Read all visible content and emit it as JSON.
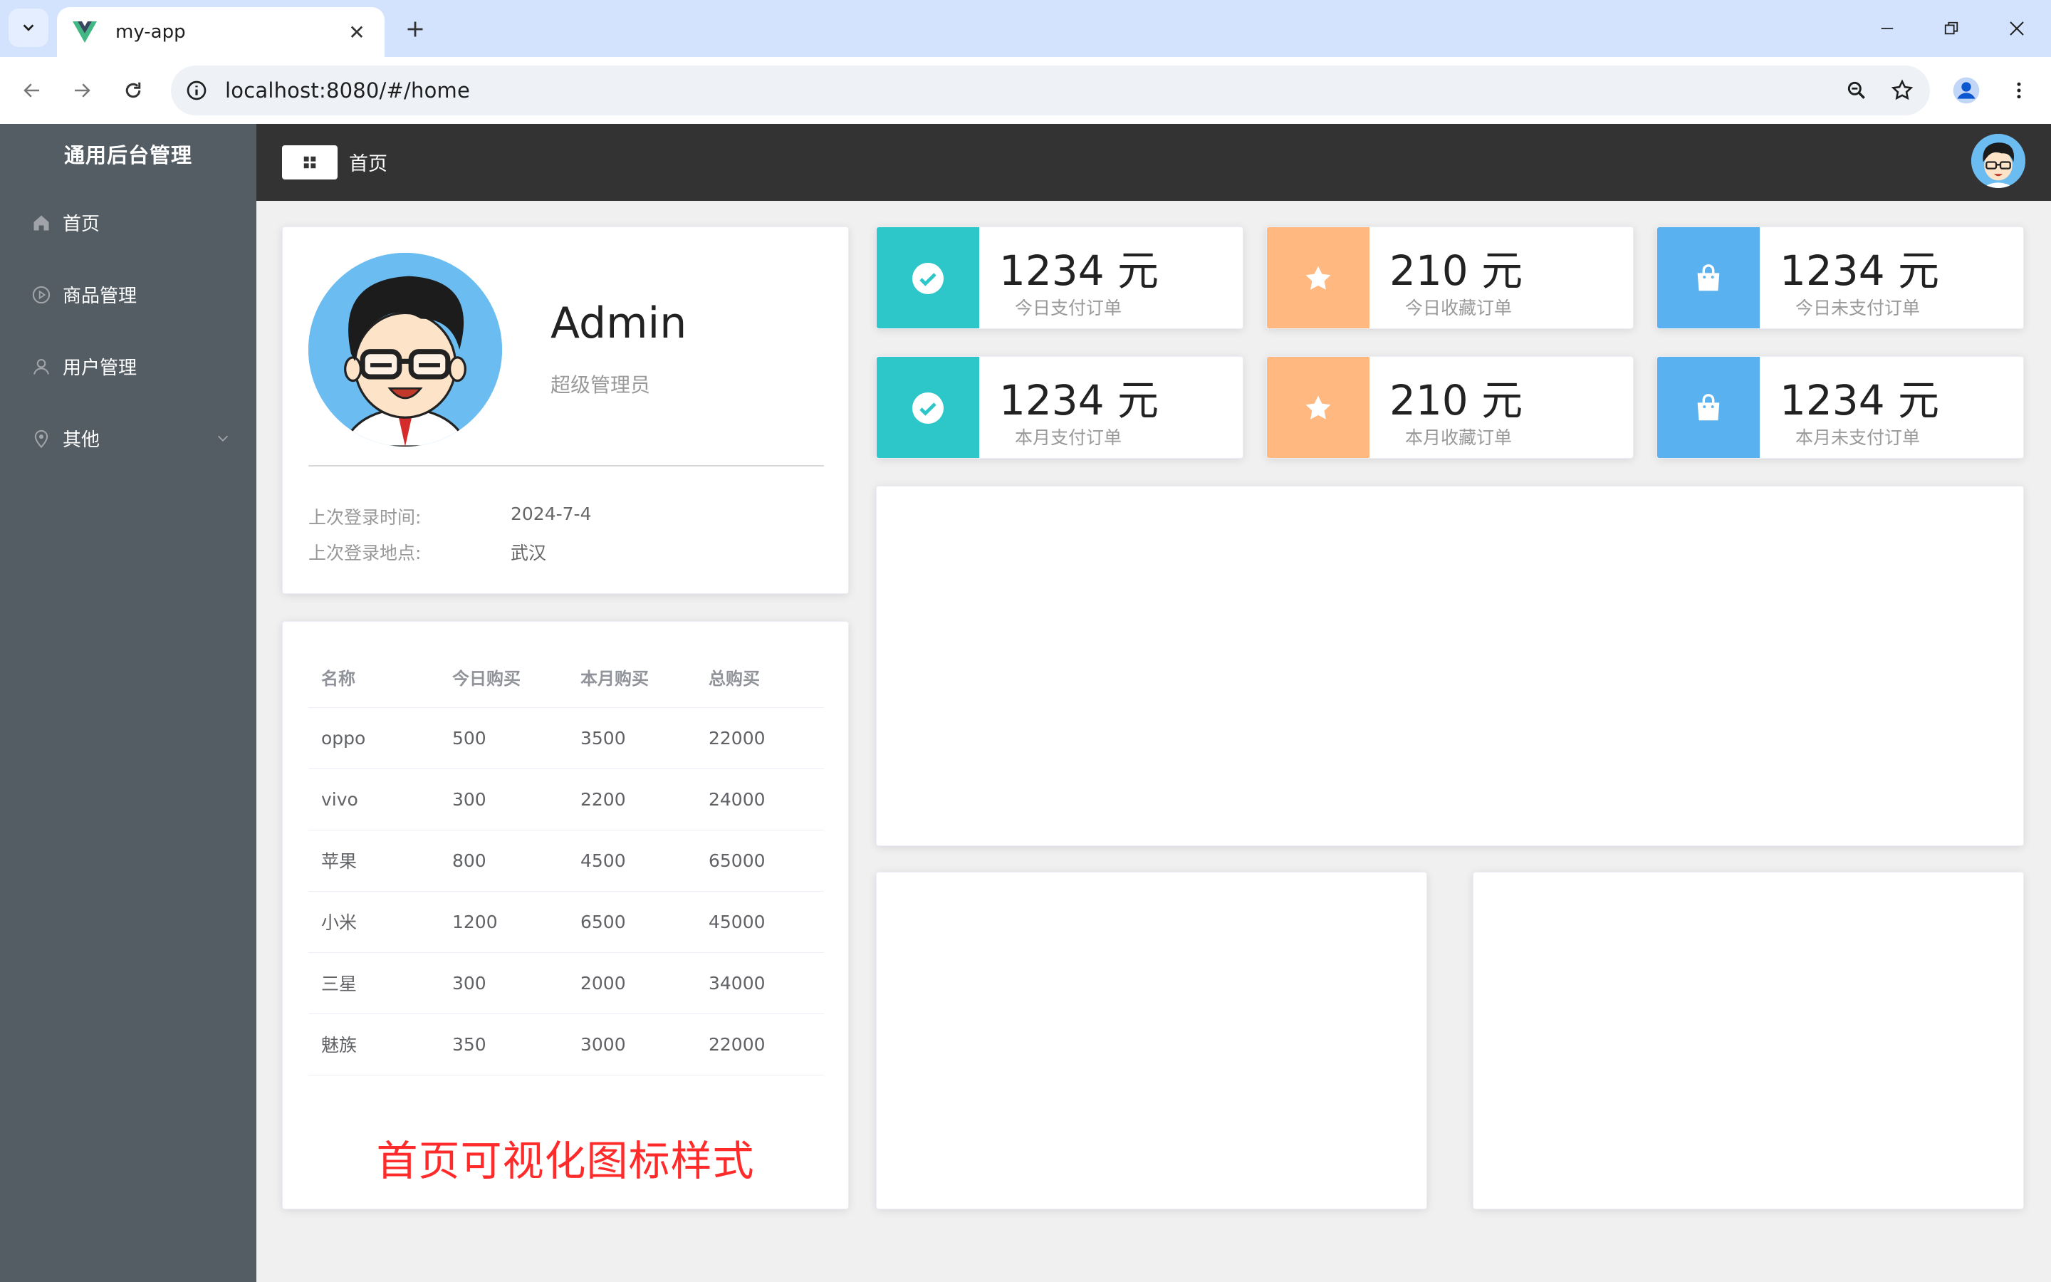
{
  "browser": {
    "tab_title": "my-app",
    "url": "localhost:8080/#/home"
  },
  "sidebar": {
    "brand": "通用后台管理",
    "items": [
      {
        "label": "首页",
        "icon": "home-icon"
      },
      {
        "label": "商品管理",
        "icon": "video-play-icon"
      },
      {
        "label": "用户管理",
        "icon": "user-icon"
      },
      {
        "label": "其他",
        "icon": "location-icon"
      }
    ]
  },
  "header": {
    "breadcrumb": "首页"
  },
  "user": {
    "name": "Admin",
    "role": "超级管理员",
    "last_login_time_label": "上次登录时间:",
    "last_login_time": "2024-7-4",
    "last_login_place_label": "上次登录地点:",
    "last_login_place": "武汉"
  },
  "table": {
    "headers": [
      "名称",
      "今日购买",
      "本月购买",
      "总购买"
    ],
    "rows": [
      [
        "oppo",
        "500",
        "3500",
        "22000"
      ],
      [
        "vivo",
        "300",
        "2200",
        "24000"
      ],
      [
        "苹果",
        "800",
        "4500",
        "65000"
      ],
      [
        "小米",
        "1200",
        "6500",
        "45000"
      ],
      [
        "三星",
        "300",
        "2000",
        "34000"
      ],
      [
        "魅族",
        "350",
        "3000",
        "22000"
      ]
    ]
  },
  "overlay_caption": "首页可视化图标样式",
  "count_cards": [
    {
      "value": "1234 元",
      "label": "今日支付订单",
      "icon": "success-icon",
      "color": "#2ec7c9"
    },
    {
      "value": "210 元",
      "label": "今日收藏订单",
      "icon": "star-icon",
      "color": "#ffb980"
    },
    {
      "value": "1234 元",
      "label": "今日未支付订单",
      "icon": "goods-bag-icon",
      "color": "#5ab1ef"
    },
    {
      "value": "1234 元",
      "label": "本月支付订单",
      "icon": "success-icon",
      "color": "#2ec7c9"
    },
    {
      "value": "210 元",
      "label": "本月收藏订单",
      "icon": "star-icon",
      "color": "#ffb980"
    },
    {
      "value": "1234 元",
      "label": "本月未支付订单",
      "icon": "goods-bag-icon",
      "color": "#5ab1ef"
    }
  ],
  "colors": {
    "sidebar_bg": "#545c64",
    "header_bg": "#333333",
    "teal": "#2ec7c9",
    "orange": "#ffb980",
    "blue": "#5ab1ef",
    "caption_red": "#ff2a2a"
  }
}
